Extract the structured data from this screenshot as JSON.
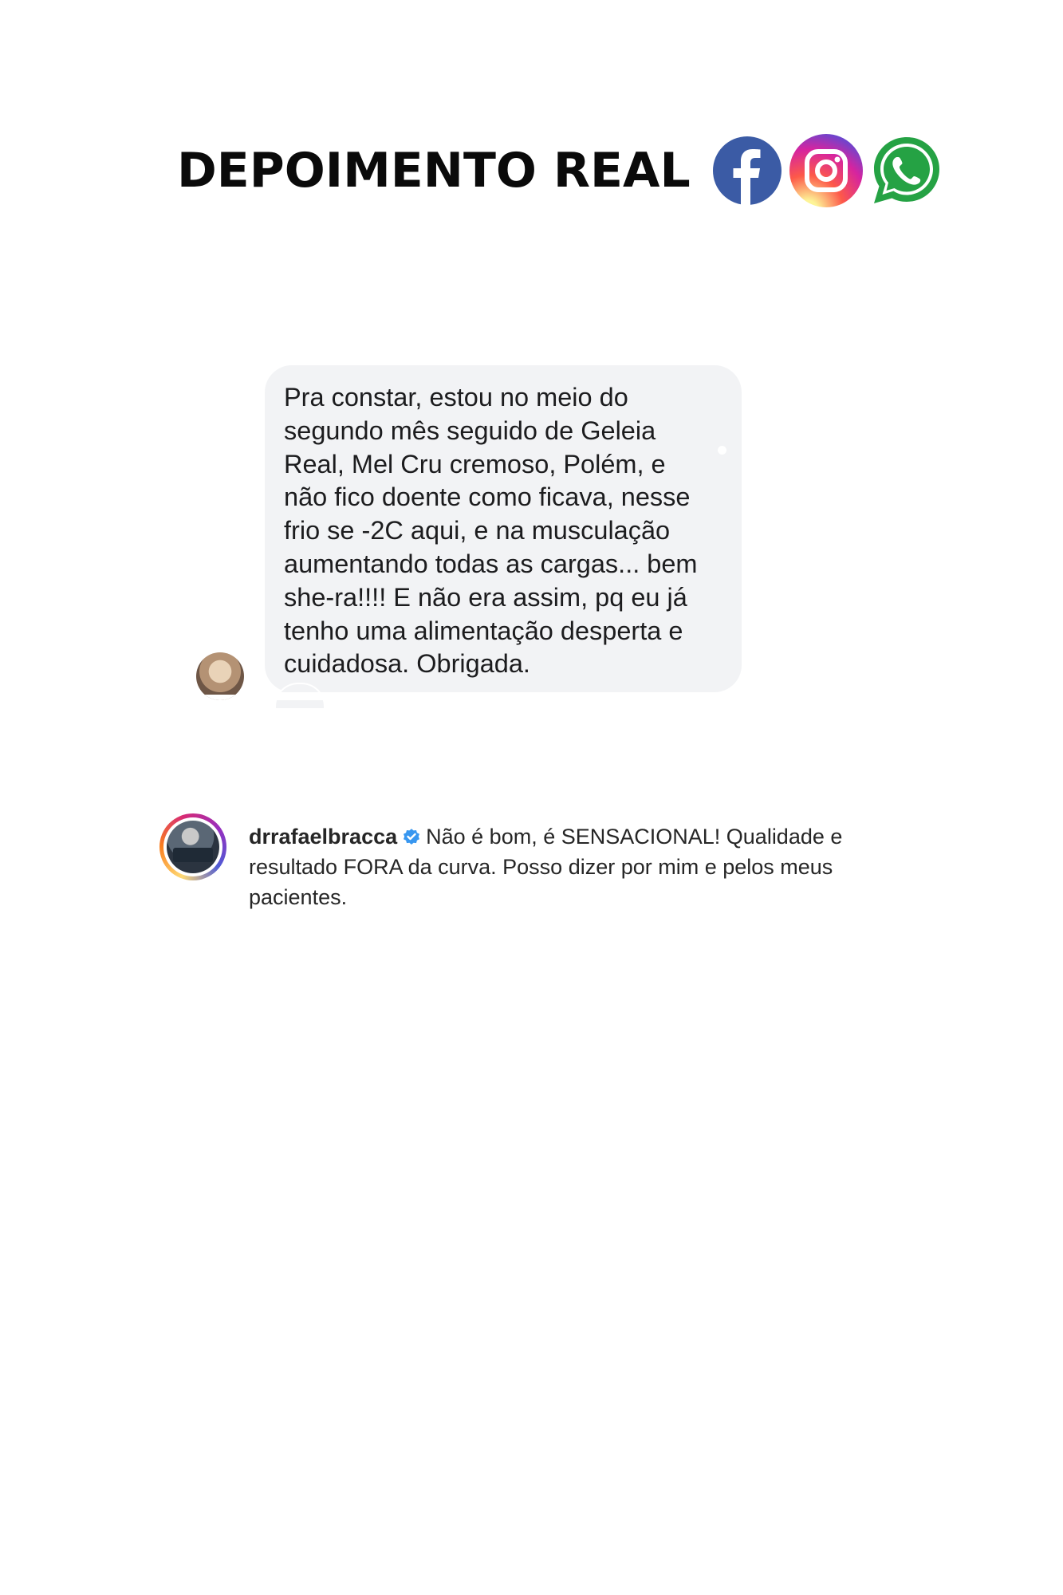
{
  "header": {
    "title": "DEPOIMENTO REAL",
    "icons": [
      "facebook-icon",
      "instagram-icon",
      "whatsapp-icon"
    ],
    "colors": {
      "facebook": "#3b5ba5",
      "whatsapp": "#25a244"
    }
  },
  "message": {
    "lines": [
      "Pra constar, estou no meio do",
      "segundo mês seguido de Geleia",
      "Real, Mel Cru cremoso, Polém, e",
      "não fico doente como ficava, nesse",
      "frio se -2C aqui, e na musculação",
      "aumentando todas as cargas... bem",
      "she-ra!!!! E não era assim, pq eu já",
      "tenho uma alimentação desperta e",
      "cuidadosa. Obrigada."
    ],
    "bubble_color": "#f2f3f5"
  },
  "comment": {
    "username": "drrafaelbracca",
    "text_line1": "Não é bom, é SENSACIONAL! Qualidade e",
    "text_line2": "resultado FORA da curva. Posso dizer por mim e pelos meus",
    "text_line3": "pacientes.",
    "verified_color": "#3897f0"
  }
}
